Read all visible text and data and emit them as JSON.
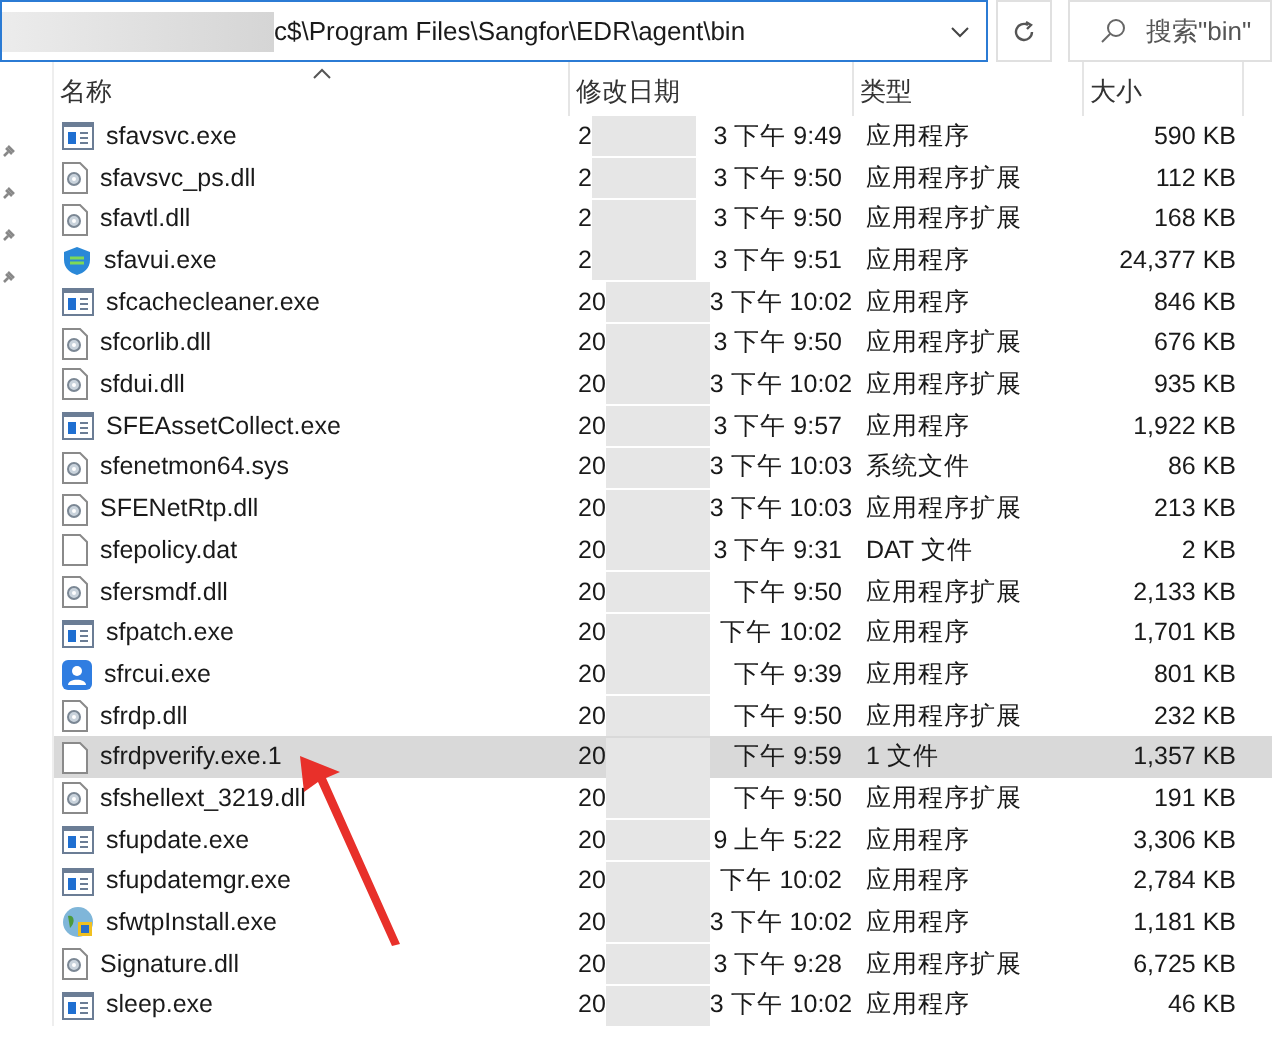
{
  "address_bar": {
    "path": "c$\\Program Files\\Sangfor\\EDR\\agent\\bin"
  },
  "search": {
    "placeholder": "搜索\"bin\""
  },
  "columns": [
    {
      "label": "名称",
      "sorted": true
    },
    {
      "label": "修改日期",
      "sorted": false
    },
    {
      "label": "类型",
      "sorted": false
    },
    {
      "label": "大小",
      "sorted": false
    }
  ],
  "quick_access_pins": [
    {
      "pinned": true
    },
    {
      "pinned": true
    },
    {
      "pinned": true
    },
    {
      "pinned": true
    }
  ],
  "files": [
    {
      "name": "sfavsvc.exe",
      "kind": "app",
      "modified_start": "2",
      "modified_end": "3 下午 9:49",
      "type": "应用程序",
      "size": "590 KB",
      "selected": false
    },
    {
      "name": "sfavsvc_ps.dll",
      "kind": "dll",
      "modified_start": "2",
      "modified_end": "3 下午 9:50",
      "type": "应用程序扩展",
      "size": "112 KB",
      "selected": false
    },
    {
      "name": "sfavtl.dll",
      "kind": "dll",
      "modified_start": "2",
      "modified_end": "3 下午 9:50",
      "type": "应用程序扩展",
      "size": "168 KB",
      "selected": false
    },
    {
      "name": "sfavui.exe",
      "kind": "shield",
      "modified_start": "2",
      "modified_end": "3 下午 9:51",
      "type": "应用程序",
      "size": "24,377 KB",
      "selected": false
    },
    {
      "name": "sfcachecleaner.exe",
      "kind": "app",
      "modified_start": "20",
      "modified_end": "3 下午 10:02",
      "type": "应用程序",
      "size": "846 KB",
      "selected": false
    },
    {
      "name": "sfcorlib.dll",
      "kind": "dll",
      "modified_start": "20",
      "modified_end": "3 下午 9:50",
      "type": "应用程序扩展",
      "size": "676 KB",
      "selected": false
    },
    {
      "name": "sfdui.dll",
      "kind": "dll",
      "modified_start": "20",
      "modified_end": "3 下午 10:02",
      "type": "应用程序扩展",
      "size": "935 KB",
      "selected": false
    },
    {
      "name": "SFEAssetCollect.exe",
      "kind": "app",
      "modified_start": "20",
      "modified_end": "3 下午 9:57",
      "type": "应用程序",
      "size": "1,922 KB",
      "selected": false
    },
    {
      "name": "sfenetmon64.sys",
      "kind": "dll",
      "modified_start": "20",
      "modified_end": "3 下午 10:03",
      "type": "系统文件",
      "size": "86 KB",
      "selected": false
    },
    {
      "name": "SFENetRtp.dll",
      "kind": "dll",
      "modified_start": "20",
      "modified_end": "3 下午 10:03",
      "type": "应用程序扩展",
      "size": "213 KB",
      "selected": false
    },
    {
      "name": "sfepolicy.dat",
      "kind": "file",
      "modified_start": "20",
      "modified_end": "3 下午 9:31",
      "type": "DAT 文件",
      "size": "2 KB",
      "selected": false
    },
    {
      "name": "sfersmdf.dll",
      "kind": "dll",
      "modified_start": "20",
      "modified_end": "下午 9:50",
      "type": "应用程序扩展",
      "size": "2,133 KB",
      "selected": false
    },
    {
      "name": "sfpatch.exe",
      "kind": "app",
      "modified_start": "20",
      "modified_end": "下午 10:02",
      "type": "应用程序",
      "size": "1,701 KB",
      "selected": false
    },
    {
      "name": "sfrcui.exe",
      "kind": "user",
      "modified_start": "20",
      "modified_end": "下午 9:39",
      "type": "应用程序",
      "size": "801 KB",
      "selected": false
    },
    {
      "name": "sfrdp.dll",
      "kind": "dll",
      "modified_start": "20",
      "modified_end": "下午 9:50",
      "type": "应用程序扩展",
      "size": "232 KB",
      "selected": false
    },
    {
      "name": "sfrdpverify.exe.1",
      "kind": "file",
      "modified_start": "20",
      "modified_end": "下午 9:59",
      "type": "1 文件",
      "size": "1,357 KB",
      "selected": true
    },
    {
      "name": "sfshellext_3219.dll",
      "kind": "dll",
      "modified_start": "20",
      "modified_end": "下午 9:50",
      "type": "应用程序扩展",
      "size": "191 KB",
      "selected": false
    },
    {
      "name": "sfupdate.exe",
      "kind": "app",
      "modified_start": "20",
      "modified_end": "9 上午 5:22",
      "type": "应用程序",
      "size": "3,306 KB",
      "selected": false
    },
    {
      "name": "sfupdatemgr.exe",
      "kind": "app",
      "modified_start": "20",
      "modified_end": "下午 10:02",
      "type": "应用程序",
      "size": "2,784 KB",
      "selected": false
    },
    {
      "name": "sfwtpInstall.exe",
      "kind": "globe",
      "modified_start": "20",
      "modified_end": "3 下午 10:02",
      "type": "应用程序",
      "size": "1,181 KB",
      "selected": false
    },
    {
      "name": "Signature.dll",
      "kind": "dll",
      "modified_start": "20",
      "modified_end": "3 下午 9:28",
      "type": "应用程序扩展",
      "size": "6,725 KB",
      "selected": false
    },
    {
      "name": "sleep.exe",
      "kind": "app",
      "modified_start": "20",
      "modified_end": "3 下午 10:02",
      "type": "应用程序",
      "size": "46 KB",
      "selected": false
    }
  ]
}
